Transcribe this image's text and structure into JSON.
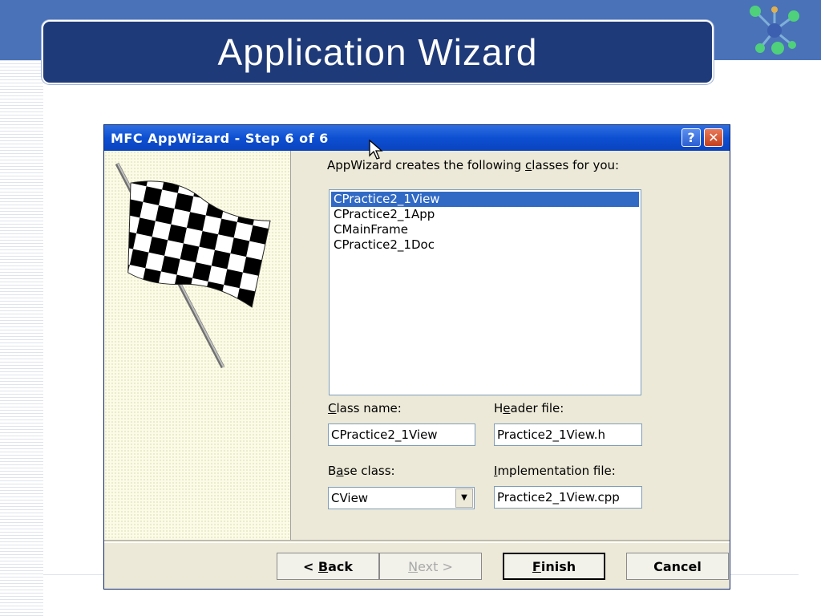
{
  "slide": {
    "title": "Application Wizard"
  },
  "dialog": {
    "title": "MFC AppWizard - Step 6 of 6",
    "help_button": "?",
    "close_button": "✕",
    "classes_label_part1": "AppWizard creates the following ",
    "classes_label_ul": "c",
    "classes_label_part2": "lasses for you:",
    "classes": [
      "CPractice2_1View",
      "CPractice2_1App",
      "CMainFrame",
      "CPractice2_1Doc"
    ],
    "selected_index": 0,
    "class_name_label_ul": "C",
    "class_name_label_rest": "lass name:",
    "class_name_value": "CPractice2_1View",
    "header_file_label_a": "H",
    "header_file_label_ul": "e",
    "header_file_label_b": "ader file:",
    "header_file_value": "Practice2_1View.h",
    "base_class_label_a": "B",
    "base_class_label_ul": "a",
    "base_class_label_b": "se class:",
    "base_class_value": "CView",
    "impl_file_label_ul": "I",
    "impl_file_label_rest": "mplementation file:",
    "impl_file_value": "Practice2_1View.cpp",
    "buttons": {
      "back_prefix": "< ",
      "back_ul": "B",
      "back_rest": "ack",
      "next_ul": "N",
      "next_rest": "ext >",
      "finish_ul": "F",
      "finish_rest": "inish",
      "cancel": "Cancel"
    }
  },
  "colors": {
    "slide_band": "#4a72b8",
    "title_panel": "#1f3a78",
    "dialog_titlebar": "#0d4fd2",
    "selection": "#316ac5",
    "dialog_bg": "#ece9d8"
  },
  "icons": [
    "molecule-icon",
    "checkered-flag-icon",
    "help-icon",
    "close-icon",
    "dropdown-arrow-icon",
    "mouse-cursor-icon"
  ]
}
